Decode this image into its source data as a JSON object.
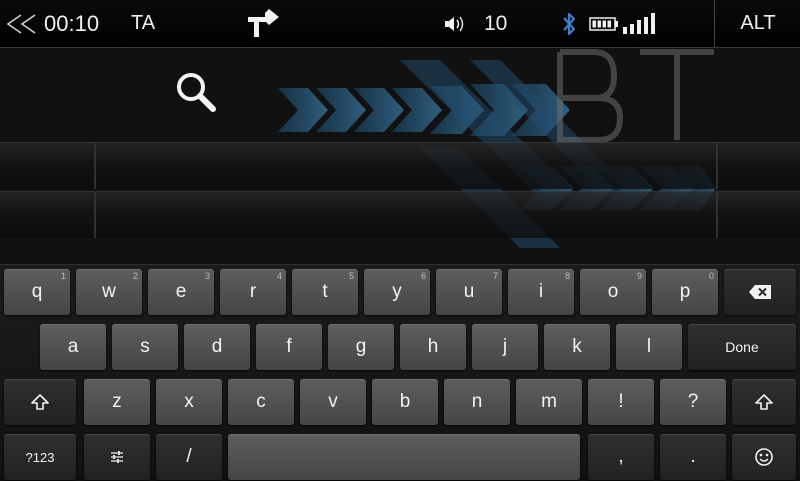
{
  "status_bar": {
    "back_icon": "double-chevron-left-icon",
    "time": "00:10",
    "ta_label": "TA",
    "nav_icon": "turn-right-arrow-icon",
    "volume_icon": "speaker-icon",
    "volume_level": "10",
    "bluetooth_icon": "bluetooth-icon",
    "battery_icon": "battery-icon",
    "signal_icon": "signal-bars-icon",
    "signal_bars": 5,
    "alt_label": "ALT"
  },
  "content": {
    "background_text": "BT",
    "search_icon": "search-icon"
  },
  "keyboard": {
    "row1": [
      {
        "label": "q",
        "hint": "1"
      },
      {
        "label": "w",
        "hint": "2"
      },
      {
        "label": "e",
        "hint": "3"
      },
      {
        "label": "r",
        "hint": "4"
      },
      {
        "label": "t",
        "hint": "5"
      },
      {
        "label": "y",
        "hint": "6"
      },
      {
        "label": "u",
        "hint": "7"
      },
      {
        "label": "i",
        "hint": "8"
      },
      {
        "label": "o",
        "hint": "9"
      },
      {
        "label": "p",
        "hint": "0"
      }
    ],
    "row2": [
      "a",
      "s",
      "d",
      "f",
      "g",
      "h",
      "j",
      "k",
      "l"
    ],
    "row3": [
      "z",
      "x",
      "c",
      "v",
      "b",
      "n",
      "m",
      "!",
      "?"
    ],
    "done_label": "Done",
    "symbols_label": "?123",
    "slash_label": "/",
    "comma_label": ",",
    "period_label": ".",
    "backspace_icon": "backspace-icon",
    "shift_icon": "shift-icon",
    "settings_icon": "settings-sliders-icon",
    "emoji_icon": "emoji-icon"
  },
  "colors": {
    "accent_blue": "#2e6f9c",
    "bluetooth_blue": "#3d7fd0",
    "key_face": "#555555"
  }
}
